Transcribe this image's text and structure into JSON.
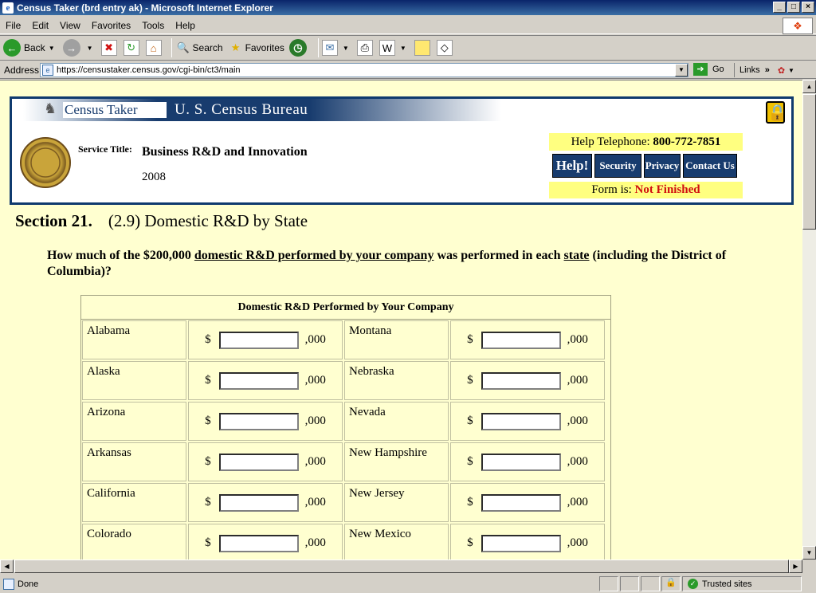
{
  "window": {
    "title": "Census Taker (brd entry ak) - Microsoft Internet Explorer"
  },
  "menu": [
    "File",
    "Edit",
    "View",
    "Favorites",
    "Tools",
    "Help"
  ],
  "toolbar": {
    "back": "Back",
    "search": "Search",
    "favorites": "Favorites"
  },
  "address": {
    "label": "Address",
    "url": "https://censustaker.census.gov/cgi-bin/ct3/main",
    "go": "Go",
    "links": "Links"
  },
  "header": {
    "census_taker": "Census Taker",
    "bureau": "U. S. Census Bureau",
    "service_title_label": "Service Title:",
    "service_title": "Business R&D and Innovation",
    "year": "2008",
    "help_tel_label": "Help Telephone:",
    "help_tel_number": "800-772-7851",
    "nav": {
      "help": "Help!",
      "security": "Security",
      "privacy": "Privacy",
      "contact": "Contact Us"
    },
    "form_status_label": "Form is:",
    "form_status": "Not Finished"
  },
  "section": {
    "number": "Section 21.",
    "title": "(2.9) Domestic R&D by State"
  },
  "question": {
    "p1": "How much of the $200,000 ",
    "u1": "domestic R&D performed by your company",
    "p2": " was performed in each ",
    "u2": "state",
    "p3": " (including the District of Columbia)?"
  },
  "table": {
    "heading": "Domestic R&D Performed by Your Company",
    "currency": "$",
    "suffix": ",000",
    "rows": [
      [
        "Alabama",
        "Montana"
      ],
      [
        "Alaska",
        "Nebraska"
      ],
      [
        "Arizona",
        "Nevada"
      ],
      [
        "Arkansas",
        "New Hampshire"
      ],
      [
        "California",
        "New Jersey"
      ],
      [
        "Colorado",
        "New Mexico"
      ]
    ]
  },
  "status": {
    "text": "Done",
    "zone": "Trusted sites"
  }
}
